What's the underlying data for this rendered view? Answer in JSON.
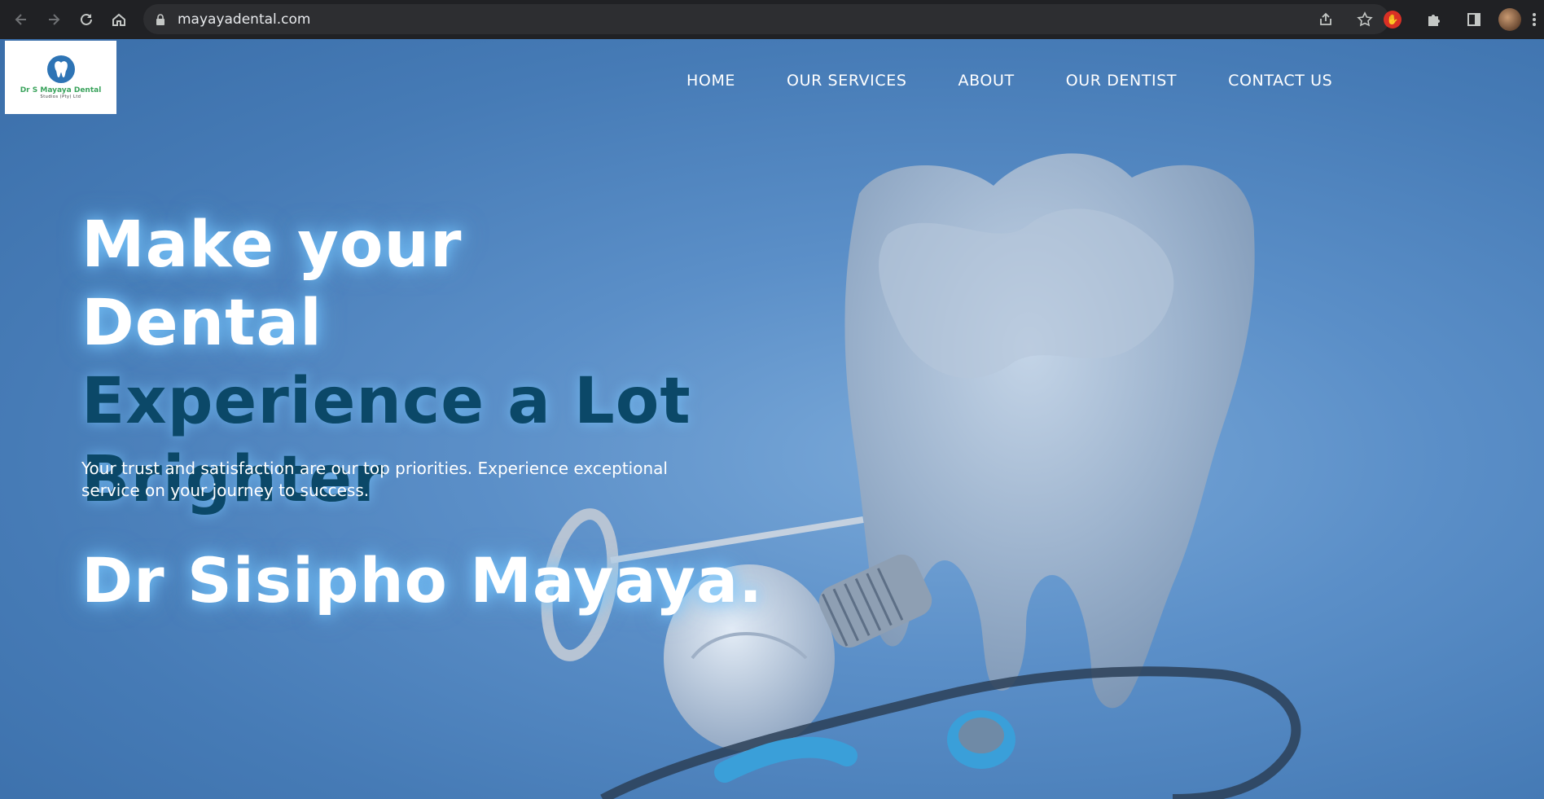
{
  "browser": {
    "url": "mayayadental.com",
    "icons": [
      "back-icon",
      "forward-icon",
      "reload-icon",
      "home-icon",
      "lock-icon",
      "share-icon",
      "bookmark-star-icon",
      "extension-icon",
      "puzzle-icon",
      "sidepanel-icon",
      "profile-avatar",
      "menu-icon"
    ]
  },
  "site": {
    "logo_name": "Dr S Mayaya Dental",
    "logo_sub": "Studios (Pty) Ltd",
    "nav": [
      "HOME",
      "OUR SERVICES",
      "ABOUT",
      "OUR DENTIST",
      "CONTACT US"
    ],
    "hero": {
      "line1": "Make your Dental",
      "line2": "Experience a Lot",
      "line3": "Brighter",
      "tagline": "Your trust and satisfaction are our top priorities. Experience exceptional service on your journey to success.",
      "doctor": "Dr Sisipho Mayaya."
    },
    "colors": {
      "bg": "#467bb6",
      "heading_dark": "#0b4868",
      "logo_green": "#3aa35c"
    }
  }
}
